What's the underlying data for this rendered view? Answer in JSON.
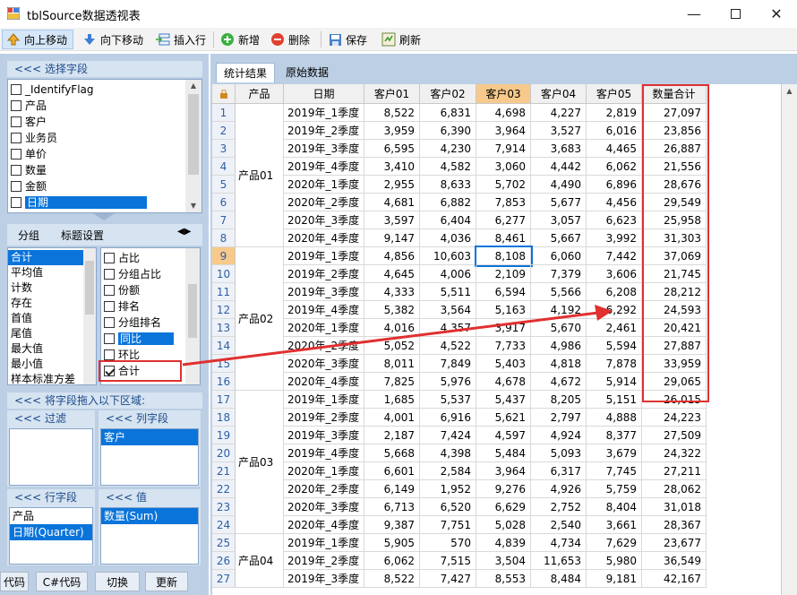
{
  "window": {
    "title": "tblSource数据透视表"
  },
  "toolbar": {
    "move_up": "向上移动",
    "move_down": "向下移动",
    "insert_row": "插入行",
    "add": "新增",
    "delete": "删除",
    "save": "保存",
    "refresh": "刷新"
  },
  "left": {
    "select_fields_header": "<<< 选择字段",
    "fields": [
      {
        "label": "_IdentifyFlag",
        "checked": false
      },
      {
        "label": "产品",
        "checked": false
      },
      {
        "label": "客户",
        "checked": false
      },
      {
        "label": "业务员",
        "checked": false
      },
      {
        "label": "单价",
        "checked": false
      },
      {
        "label": "数量",
        "checked": false
      },
      {
        "label": "金额",
        "checked": false
      },
      {
        "label": "日期",
        "checked": false
      }
    ],
    "tabs": {
      "group": "分组",
      "title_settings": "标题设置"
    },
    "aggregates": [
      "合计",
      "平均值",
      "计数",
      "存在",
      "首值",
      "尾值",
      "最大值",
      "最小值",
      "样本标准方差"
    ],
    "calc_items": [
      {
        "label": "占比",
        "checked": false
      },
      {
        "label": "分组占比",
        "checked": false
      },
      {
        "label": "份额",
        "checked": false
      },
      {
        "label": "排名",
        "checked": false
      },
      {
        "label": "分组排名",
        "checked": false
      },
      {
        "label": "同比",
        "checked": false
      },
      {
        "label": "环比",
        "checked": false
      },
      {
        "label": "合计",
        "checked": true
      }
    ],
    "drag_hint": "<<< 将字段拖入以下区域:",
    "filter_header": "<<< 过滤",
    "column_header": "<<< 列字段",
    "column_fields": [
      "客户"
    ],
    "row_header": "<<< 行字段",
    "row_fields": [
      "产品",
      "日期(Quarter)"
    ],
    "value_header": "<<< 值",
    "value_fields": [
      "数量(Sum)"
    ],
    "buttons": {
      "code": "代码",
      "csharp": "C#代码",
      "switch": "切换",
      "update": "更新"
    }
  },
  "tabs": {
    "stats": "统计结果",
    "raw": "原始数据"
  },
  "grid": {
    "headers": [
      "产品",
      "日期",
      "客户01",
      "客户02",
      "客户03",
      "客户04",
      "客户05",
      "数量合计"
    ],
    "rows": [
      [
        "1",
        "产品01",
        "2019年_1季度",
        "8,522",
        "6,831",
        "4,698",
        "4,227",
        "2,819",
        "27,097"
      ],
      [
        "2",
        "",
        "2019年_2季度",
        "3,959",
        "6,390",
        "3,964",
        "3,527",
        "6,016",
        "23,856"
      ],
      [
        "3",
        "",
        "2019年_3季度",
        "6,595",
        "4,230",
        "7,914",
        "3,683",
        "4,465",
        "26,887"
      ],
      [
        "4",
        "",
        "2019年_4季度",
        "3,410",
        "4,582",
        "3,060",
        "4,442",
        "6,062",
        "21,556"
      ],
      [
        "5",
        "",
        "2020年_1季度",
        "2,955",
        "8,633",
        "5,702",
        "4,490",
        "6,896",
        "28,676"
      ],
      [
        "6",
        "",
        "2020年_2季度",
        "4,681",
        "6,882",
        "7,853",
        "5,677",
        "4,456",
        "29,549"
      ],
      [
        "7",
        "",
        "2020年_3季度",
        "3,597",
        "6,404",
        "6,277",
        "3,057",
        "6,623",
        "25,958"
      ],
      [
        "8",
        "",
        "2020年_4季度",
        "9,147",
        "4,036",
        "8,461",
        "5,667",
        "3,992",
        "31,303"
      ],
      [
        "9",
        "产品02",
        "2019年_1季度",
        "4,856",
        "10,603",
        "8,108",
        "6,060",
        "7,442",
        "37,069"
      ],
      [
        "10",
        "",
        "2019年_2季度",
        "4,645",
        "4,006",
        "2,109",
        "7,379",
        "3,606",
        "21,745"
      ],
      [
        "11",
        "",
        "2019年_3季度",
        "4,333",
        "5,511",
        "6,594",
        "5,566",
        "6,208",
        "28,212"
      ],
      [
        "12",
        "",
        "2019年_4季度",
        "5,382",
        "3,564",
        "5,163",
        "4,192",
        "6,292",
        "24,593"
      ],
      [
        "13",
        "",
        "2020年_1季度",
        "4,016",
        "4,357",
        "3,917",
        "5,670",
        "2,461",
        "20,421"
      ],
      [
        "14",
        "",
        "2020年_2季度",
        "5,052",
        "4,522",
        "7,733",
        "4,986",
        "5,594",
        "27,887"
      ],
      [
        "15",
        "",
        "2020年_3季度",
        "8,011",
        "7,849",
        "5,403",
        "4,818",
        "7,878",
        "33,959"
      ],
      [
        "16",
        "",
        "2020年_4季度",
        "7,825",
        "5,976",
        "4,678",
        "4,672",
        "5,914",
        "29,065"
      ],
      [
        "17",
        "产品03",
        "2019年_1季度",
        "1,685",
        "5,537",
        "5,437",
        "8,205",
        "5,151",
        "26,015"
      ],
      [
        "18",
        "",
        "2019年_2季度",
        "4,001",
        "6,916",
        "5,621",
        "2,797",
        "4,888",
        "24,223"
      ],
      [
        "19",
        "",
        "2019年_3季度",
        "2,187",
        "7,424",
        "4,597",
        "4,924",
        "8,377",
        "27,509"
      ],
      [
        "20",
        "",
        "2019年_4季度",
        "5,668",
        "4,398",
        "5,484",
        "5,093",
        "3,679",
        "24,322"
      ],
      [
        "21",
        "",
        "2020年_1季度",
        "6,601",
        "2,584",
        "3,964",
        "6,317",
        "7,745",
        "27,211"
      ],
      [
        "22",
        "",
        "2020年_2季度",
        "6,149",
        "1,952",
        "9,276",
        "4,926",
        "5,759",
        "28,062"
      ],
      [
        "23",
        "",
        "2020年_3季度",
        "6,713",
        "6,520",
        "6,629",
        "2,752",
        "8,404",
        "31,018"
      ],
      [
        "24",
        "",
        "2020年_4季度",
        "9,387",
        "7,751",
        "5,028",
        "2,540",
        "3,661",
        "28,367"
      ],
      [
        "25",
        "产品04",
        "2019年_1季度",
        "5,905",
        "570",
        "4,839",
        "4,734",
        "7,629",
        "23,677"
      ],
      [
        "26",
        "",
        "2019年_2季度",
        "6,062",
        "7,515",
        "3,504",
        "11,653",
        "5,980",
        "36,549"
      ],
      [
        "27",
        "",
        "2019年_3季度",
        "8,522",
        "7,427",
        "8,553",
        "8,484",
        "9,181",
        "42,167"
      ]
    ]
  },
  "colors": {
    "accent": "#0a74da",
    "highlight": "#e03030",
    "header_selected": "#f7c98a"
  }
}
